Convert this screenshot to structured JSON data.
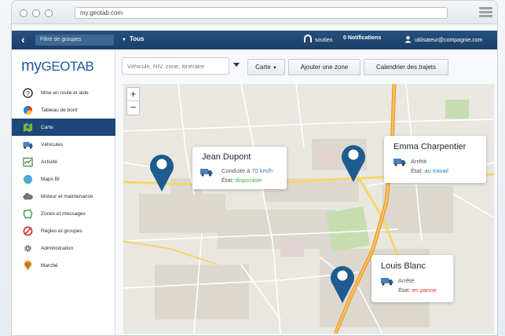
{
  "browser": {
    "url": "my.geotab.com"
  },
  "topbar": {
    "back": "‹",
    "group_filter": "Filtre de groupes",
    "group_value": "Tous",
    "support": "soutien",
    "notifications": "0 Notifications",
    "user": "utilisateur@compagnie.com"
  },
  "sidebar": {
    "logo_prefix": "my",
    "logo_main": "GEOTAB",
    "items": [
      {
        "label": "Mise en route et aide",
        "icon": "help-icon"
      },
      {
        "label": "Tableau de bord",
        "icon": "dashboard-icon"
      },
      {
        "label": "Carte",
        "icon": "map-icon",
        "active": true
      },
      {
        "label": "Véhicules",
        "icon": "vehicle-icon"
      },
      {
        "label": "Activité",
        "icon": "activity-icon"
      },
      {
        "label": "Maps BI",
        "icon": "globe-icon"
      },
      {
        "label": "Moteur et maintenance",
        "icon": "engine-icon"
      },
      {
        "label": "Zones et messages",
        "icon": "zone-icon"
      },
      {
        "label": "Règles et groupes",
        "icon": "rules-icon"
      },
      {
        "label": "Administration",
        "icon": "gear-icon"
      },
      {
        "label": "Marché",
        "icon": "marketplace-icon"
      }
    ]
  },
  "toolbar": {
    "search_placeholder": "Véhicule, NIV, zone, itinéraire",
    "map_button": "Carte",
    "add_zone_button": "Ajouter une zone",
    "trips_button": "Calendrier des trajets"
  },
  "map": {
    "zoom_in": "+",
    "zoom_out": "−",
    "vehicles": [
      {
        "name": "Jean Dupont",
        "line1_prefix": "Conduite à ",
        "line1_value": "70 km/h",
        "line2_prefix": "État: ",
        "line2_value": "disponible",
        "value_color": "#4caf50",
        "line1_color": "#2f7fc1"
      },
      {
        "name": "Emma Charpentier",
        "line1_prefix": "Arrêté",
        "line1_value": "",
        "line2_prefix": "État: ",
        "line2_value": "au travail",
        "value_color": "#2f7fc1"
      },
      {
        "name": "Louis Blanc",
        "line1_prefix": "Arrêté",
        "line1_value": "",
        "line2_prefix": "État: ",
        "line2_value": "en panne",
        "value_color": "#e53935"
      }
    ]
  },
  "colors": {
    "brand": "#1f5aa0",
    "topbar": "#1d4778",
    "pin": "#1e5b8e",
    "highway": "#f0a030"
  }
}
